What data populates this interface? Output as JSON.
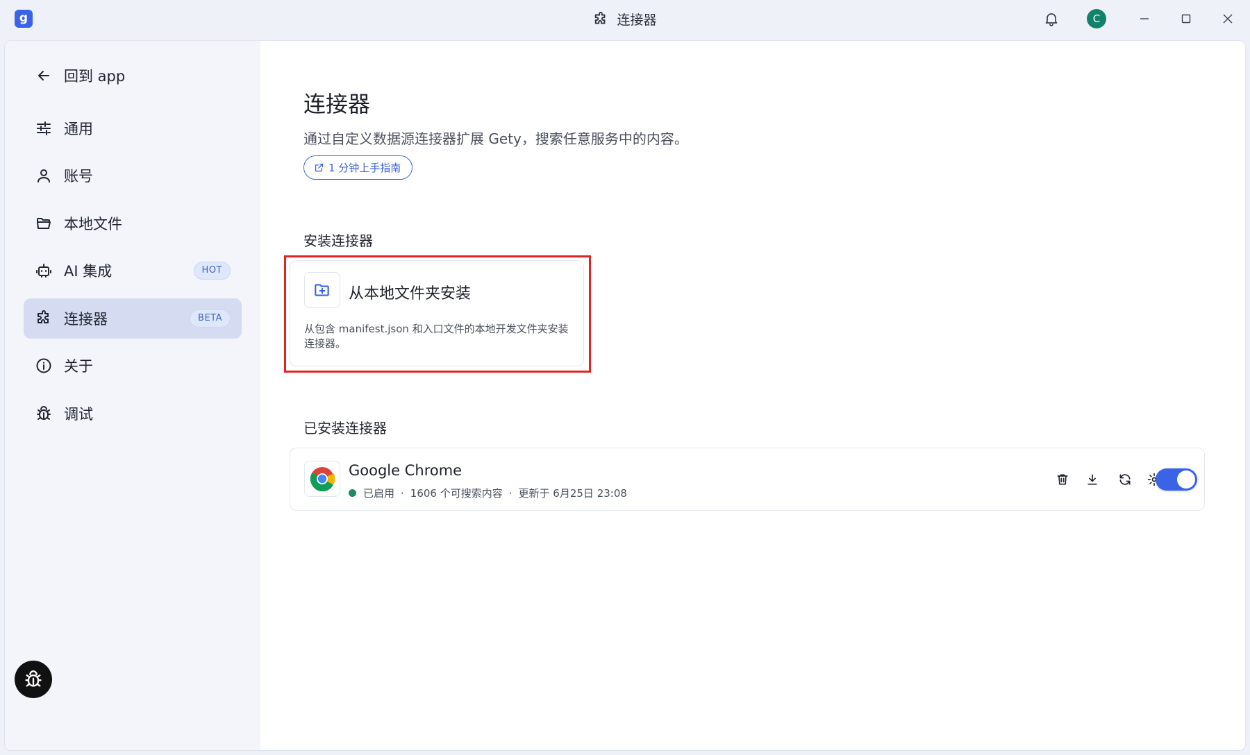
{
  "window": {
    "title": "连接器",
    "logo_letter": "g",
    "avatar_letter": "C"
  },
  "sidebar": {
    "back_label": "回到 app",
    "items": [
      {
        "label": "通用",
        "icon": "sliders-icon"
      },
      {
        "label": "账号",
        "icon": "user-icon"
      },
      {
        "label": "本地文件",
        "icon": "folder-icon"
      },
      {
        "label": "AI 集成",
        "icon": "robot-icon",
        "badge": "HOT"
      },
      {
        "label": "连接器",
        "icon": "puzzle-icon",
        "badge": "BETA",
        "active": true
      },
      {
        "label": "关于",
        "icon": "info-icon"
      },
      {
        "label": "调试",
        "icon": "bug-icon"
      }
    ]
  },
  "main": {
    "title": "连接器",
    "description": "通过自定义数据源连接器扩展 Gety，搜索任意服务中的内容。",
    "guide_label": "1 分钟上手指南",
    "install_section": {
      "title": "安装连接器",
      "card_title": "从本地文件夹安装",
      "card_description": "从包含 manifest.json 和入口文件的本地开发文件夹安装连接器。"
    },
    "installed_section": {
      "title": "已安装连接器",
      "connectors": [
        {
          "name": "Google Chrome",
          "status": "已启用",
          "count_text": "1606 个可搜索内容",
          "updated_text": "更新于 6月25日 23:08",
          "enabled": true
        }
      ]
    }
  },
  "colors": {
    "accent": "#3a63e6",
    "status_green": "#1a8a67",
    "highlight_red": "#e52222",
    "active_nav_bg": "#d5dcf2"
  }
}
